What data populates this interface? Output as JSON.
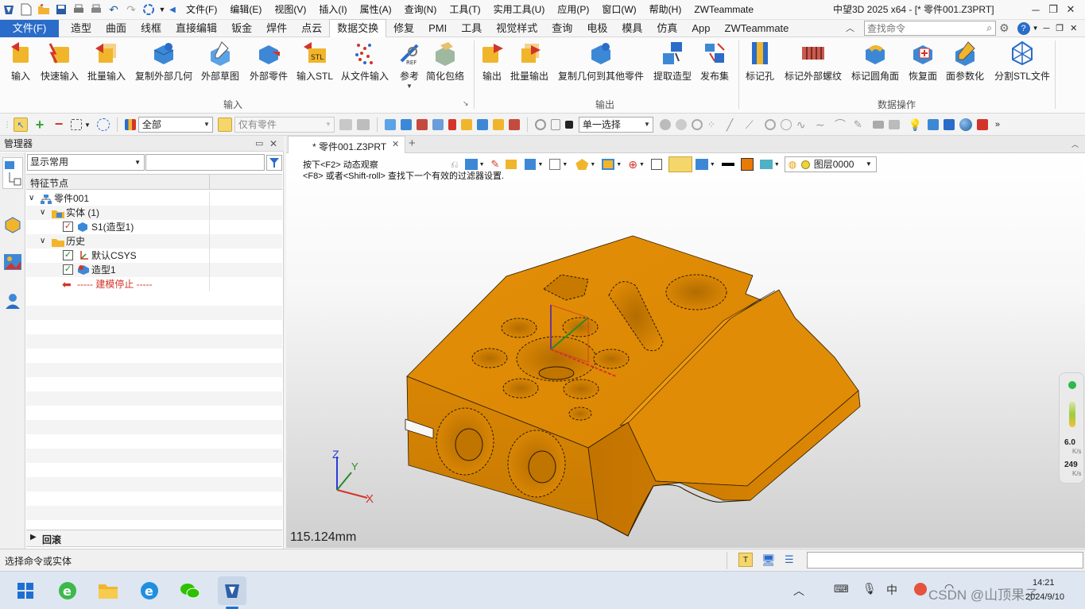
{
  "titlebar": {
    "menus": [
      "文件(F)",
      "编辑(E)",
      "视图(V)",
      "插入(I)",
      "属性(A)",
      "查询(N)",
      "工具(T)",
      "实用工具(U)",
      "应用(P)",
      "窗口(W)",
      "帮助(H)",
      "ZWTeammate"
    ],
    "title": "中望3D 2025 x64 - [* 零件001.Z3PRT]"
  },
  "tabs": {
    "items": [
      "文件(F)",
      "造型",
      "曲面",
      "线框",
      "直接编辑",
      "钣金",
      "焊件",
      "点云",
      "数据交换",
      "修复",
      "PMI",
      "工具",
      "视觉样式",
      "查询",
      "电极",
      "模具",
      "仿真",
      "App",
      "ZWTeammate"
    ],
    "active": "数据交换",
    "search_placeholder": "查找命令"
  },
  "ribbon": {
    "input_group": "输入",
    "output_group": "输出",
    "dataop_group": "数据操作",
    "buttons": [
      "输入",
      "快速输入",
      "批量输入",
      "复制外部几何",
      "外部草图",
      "外部零件",
      "输入STL",
      "从文件输入",
      "参考",
      "简化包络",
      "输出",
      "批量输出",
      "复制几何到其他零件",
      "提取造型",
      "发布集",
      "标记孔",
      "标记外部螺纹",
      "标记圆角面",
      "恢复面",
      "面参数化",
      "分割STL文件"
    ]
  },
  "toolbar2": {
    "filter_all": "全部",
    "only_part": "仅有零件",
    "select_mode": "单一选择"
  },
  "manager": {
    "title": "管理器",
    "display_mode": "显示常用",
    "column_header": "特征节点",
    "tree": {
      "part": "零件001",
      "solids": "实体 (1)",
      "s1": "S1(造型1)",
      "history": "历史",
      "csys": "默认CSYS",
      "shape": "造型1",
      "stop": "----- 建模停止 -----"
    },
    "footer": "回滚"
  },
  "viewport": {
    "doc_tab": "* 零件001.Z3PRT",
    "hint1": "按下<F2> 动态观察",
    "hint2": "<F8> 或者<Shift-roll> 查找下一个有效的过滤器设置.",
    "layer": "图层0000",
    "scale": "115.124mm",
    "axis_x": "X",
    "axis_y": "Y",
    "axis_z": "Z",
    "net_up": "6.0",
    "net_up_unit": "K/s",
    "net_down": "249",
    "net_down_unit": "K/s"
  },
  "statusbar": {
    "message": "选择命令或实体"
  },
  "taskbar": {
    "watermark": "CSDN @山顶果子",
    "time": "14:21",
    "date": "2024/9/10"
  },
  "colors": {
    "model": "#df8a04",
    "model_dark": "#b36c00",
    "accent": "#2a6cc9"
  }
}
